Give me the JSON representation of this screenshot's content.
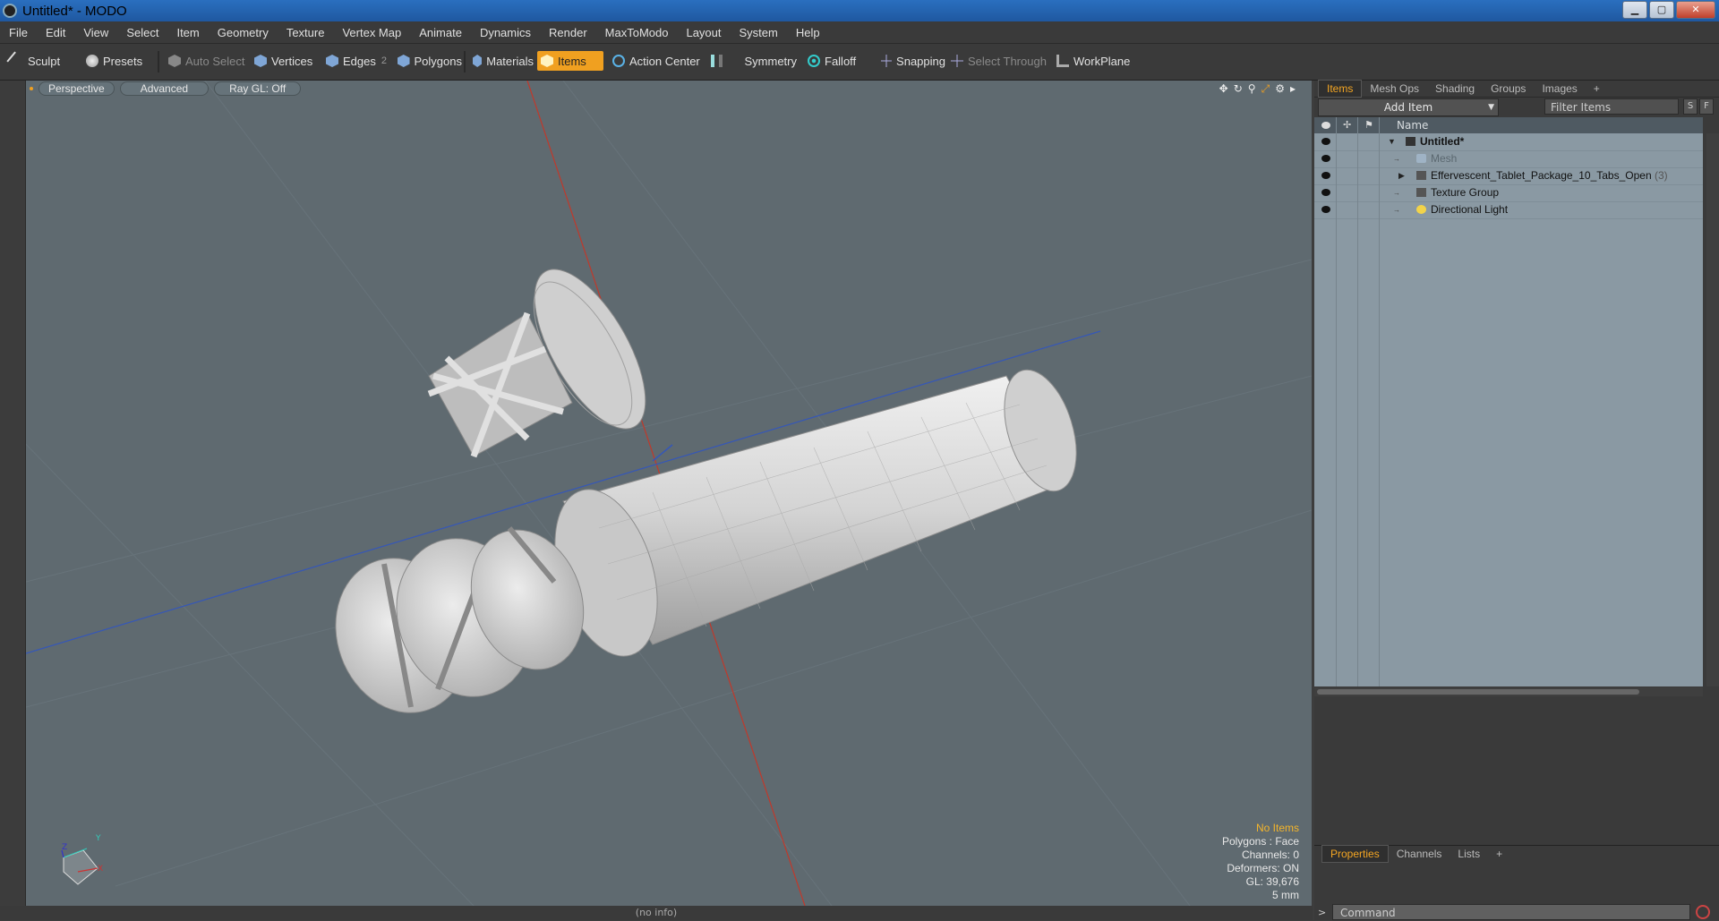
{
  "window": {
    "title": "Untitled* - MODO",
    "min": "▁",
    "max": "▢",
    "close": "✕"
  },
  "menu": [
    "File",
    "Edit",
    "View",
    "Select",
    "Item",
    "Geometry",
    "Texture",
    "Vertex Map",
    "Animate",
    "Dynamics",
    "Render",
    "MaxToModo",
    "Layout",
    "System",
    "Help"
  ],
  "toolbar": {
    "sculpt": "Sculpt",
    "presets": "Presets",
    "auto_select": "Auto Select",
    "vertices": "Vertices",
    "edges": "Edges",
    "edges_count": "2",
    "polygons": "Polygons",
    "materials": "Materials",
    "items": "Items",
    "action_center": "Action Center",
    "symmetry": "Symmetry",
    "falloff": "Falloff",
    "snapping": "Snapping",
    "select_through": "Select Through",
    "workplane": "WorkPlane"
  },
  "viewport": {
    "tabs": [
      "Perspective",
      "Advanced",
      "Ray GL: Off"
    ],
    "icons": [
      "✥",
      "↻",
      "⚲",
      "⤢",
      "⚙",
      "▸"
    ],
    "stats": {
      "selection": "No Items",
      "polygons": "Polygons : Face",
      "channels": "Channels: 0",
      "deformers": "Deformers: ON",
      "gl": "GL: 39,676",
      "scale": "5 mm"
    },
    "axis": {
      "x": "X",
      "y": "Y",
      "z": "Z"
    },
    "colors": {
      "background": "#5f6a70",
      "grid": "#66737a",
      "axis_red": "#c0392b",
      "axis_blue": "#3557b8",
      "mesh": "#d6d6d6"
    }
  },
  "panel": {
    "tabs": [
      "Items",
      "Mesh Ops",
      "Shading",
      "Groups",
      "Images",
      "+"
    ],
    "add_item": "Add Item",
    "filter_placeholder": "Filter Items",
    "s_btn": "S",
    "f_btn": "F",
    "name_header": "Name",
    "rows": [
      {
        "label": "Untitled*",
        "count": ""
      },
      {
        "label": "Mesh",
        "count": ""
      },
      {
        "label": "Effervescent_Tablet_Package_10_Tabs_Open",
        "count": "(3)"
      },
      {
        "label": "Texture Group",
        "count": ""
      },
      {
        "label": "Directional Light",
        "count": ""
      }
    ],
    "props_tabs": [
      "Properties",
      "Channels",
      "Lists",
      "+"
    ]
  },
  "status": {
    "info": "(no info)",
    "command_placeholder": "Command",
    "command_prompt": ">"
  },
  "accent": "#f0a020"
}
